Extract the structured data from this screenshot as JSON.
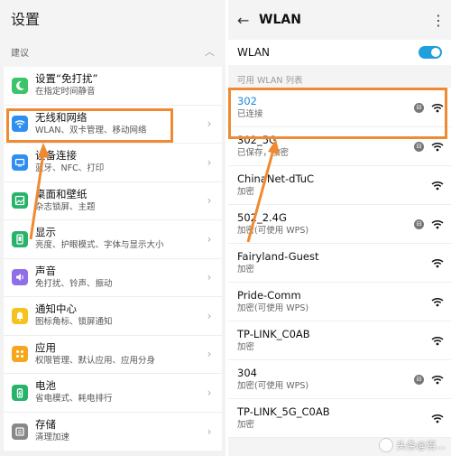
{
  "left": {
    "title": "设置",
    "section": "建议",
    "items": [
      {
        "title": "设置“免打扰”",
        "sub": "在指定时间静音",
        "icon": "moon-icon",
        "color": "#3cc46a"
      },
      {
        "title": "无线和网络",
        "sub": "WLAN、双卡管理、移动网络",
        "icon": "wifi-icon",
        "color": "#2f8ff0"
      },
      {
        "title": "设备连接",
        "sub": "蓝牙、NFC、打印",
        "icon": "device-icon",
        "color": "#2f8ff0"
      },
      {
        "title": "桌面和壁纸",
        "sub": "杂志锁屏、主题",
        "icon": "wallpaper-icon",
        "color": "#27b36a"
      },
      {
        "title": "显示",
        "sub": "亮度、护眼模式、字体与显示大小",
        "icon": "display-icon",
        "color": "#27b36a"
      },
      {
        "title": "声音",
        "sub": "免打扰、铃声、振动",
        "icon": "sound-icon",
        "color": "#8f6ee8"
      },
      {
        "title": "通知中心",
        "sub": "图标角标、锁屏通知",
        "icon": "bell-icon",
        "color": "#f6c21d"
      },
      {
        "title": "应用",
        "sub": "权限管理、默认应用、应用分身",
        "icon": "apps-icon",
        "color": "#f6a71d"
      },
      {
        "title": "电池",
        "sub": "省电模式、耗电排行",
        "icon": "battery-icon",
        "color": "#27b36a"
      },
      {
        "title": "存储",
        "sub": "清理加速",
        "icon": "storage-icon",
        "color": "#888888"
      }
    ]
  },
  "right": {
    "title": "WLAN",
    "wlan_label": "WLAN",
    "wlan_on": true,
    "available_label": "可用 WLAN 列表",
    "networks": [
      {
        "name": "302",
        "status": "已连接",
        "lock": true,
        "active": true
      },
      {
        "name": "302_5G",
        "status": "已保存，加密",
        "lock": true,
        "active": false
      },
      {
        "name": "ChinaNet-dTuC",
        "status": "加密",
        "lock": false,
        "active": false
      },
      {
        "name": "502_2.4G",
        "status": "加密(可使用 WPS)",
        "lock": true,
        "active": false
      },
      {
        "name": "Fairyland-Guest",
        "status": "加密",
        "lock": false,
        "active": false
      },
      {
        "name": "Pride-Comm",
        "status": "加密(可使用 WPS)",
        "lock": false,
        "active": false
      },
      {
        "name": "TP-LINK_C0AB",
        "status": "加密",
        "lock": false,
        "active": false
      },
      {
        "name": "304",
        "status": "加密(可使用 WPS)",
        "lock": true,
        "active": false
      },
      {
        "name": "TP-LINK_5G_C0AB",
        "status": "加密",
        "lock": false,
        "active": false
      }
    ]
  },
  "highlight_color": "#ef8a33",
  "watermark": "头条@百..."
}
